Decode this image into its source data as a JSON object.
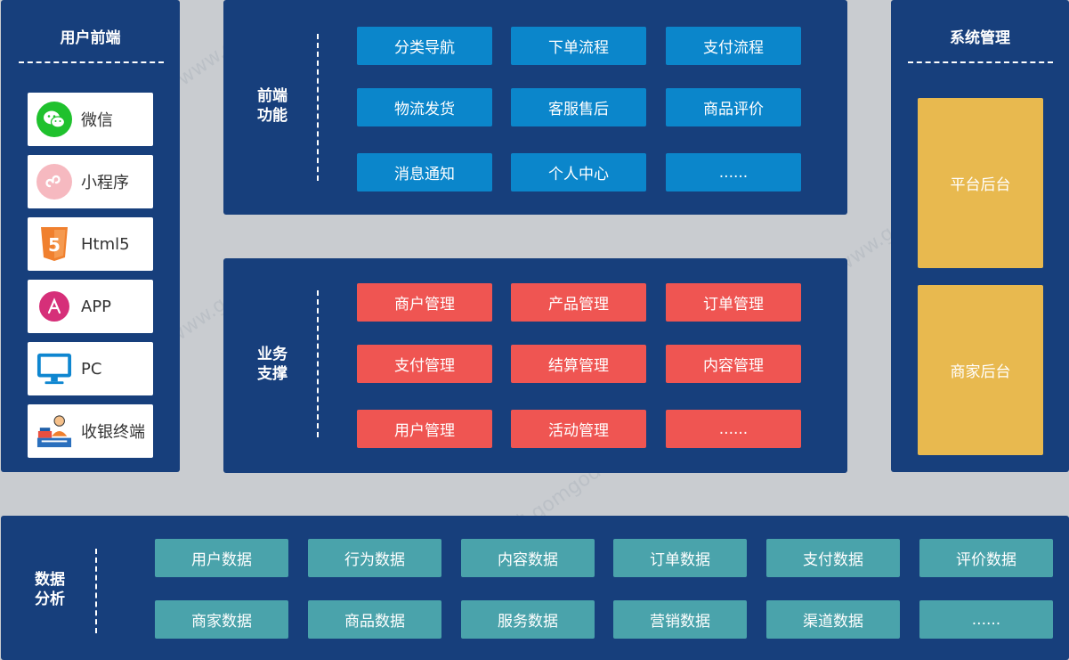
{
  "user_frontend": {
    "title": "用户前端",
    "channels": [
      {
        "label": "微信",
        "icon": "wechat-icon"
      },
      {
        "label": "小程序",
        "icon": "miniprogram-icon"
      },
      {
        "label": "Html5",
        "icon": "html5-icon"
      },
      {
        "label": "APP",
        "icon": "app-store-icon"
      },
      {
        "label": "PC",
        "icon": "monitor-icon"
      },
      {
        "label": "收银终端",
        "icon": "cashier-icon"
      }
    ]
  },
  "frontend_functions": {
    "title": "前端\n功能",
    "items": [
      "分类导航",
      "下单流程",
      "支付流程",
      "物流发货",
      "客服售后",
      "商品评价",
      "消息通知",
      "个人中心",
      "......"
    ]
  },
  "business_support": {
    "title": "业务\n支撑",
    "items": [
      "商户管理",
      "产品管理",
      "订单管理",
      "支付管理",
      "结算管理",
      "内容管理",
      "用户管理",
      "活动管理",
      "......"
    ]
  },
  "system_management": {
    "title": "系统管理",
    "items": [
      "平台后台",
      "商家后台"
    ]
  },
  "data_analysis": {
    "title": "数据\n分析",
    "items": [
      "用户数据",
      "行为数据",
      "内容数据",
      "订单数据",
      "支付数据",
      "评价数据",
      "商家数据",
      "商品数据",
      "服务数据",
      "营销数据",
      "渠道数据",
      "......"
    ]
  },
  "colors": {
    "panel": "#173f7c",
    "frontend_tile": "#0b86cb",
    "business_tile": "#ef5552",
    "data_tile": "#4aa3ab",
    "system_tile": "#e8b94f"
  }
}
